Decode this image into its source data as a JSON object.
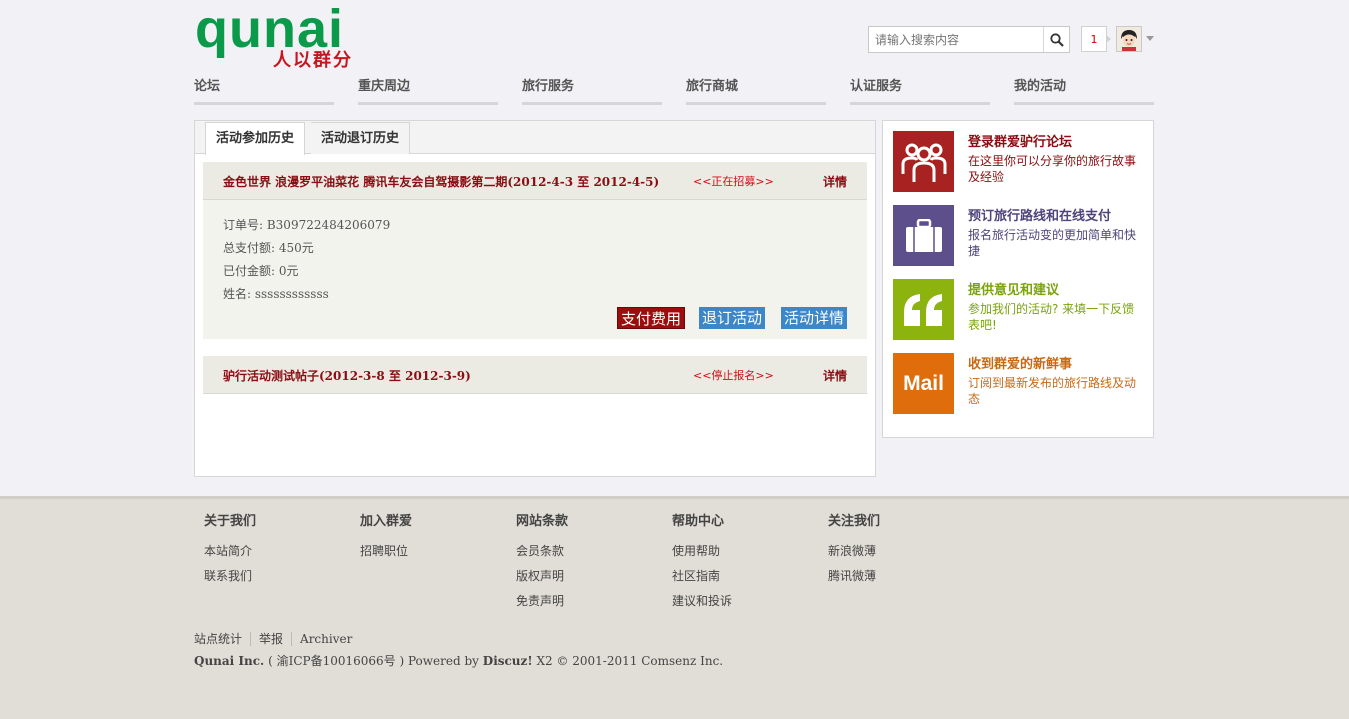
{
  "header": {
    "logo_text": "qunai",
    "logo_subtitle": "人以群分",
    "search_placeholder": "请输入搜索内容",
    "notification_count": "1"
  },
  "nav": [
    {
      "label": "论坛"
    },
    {
      "label": "重庆周边"
    },
    {
      "label": "旅行服务"
    },
    {
      "label": "旅行商城"
    },
    {
      "label": "认证服务"
    },
    {
      "label": "我的活动"
    }
  ],
  "tabs": [
    {
      "label": "活动参加历史"
    },
    {
      "label": "活动退订历史"
    }
  ],
  "activities": [
    {
      "title": "金色世界 浪漫罗平油菜花 腾讯车友会自驾摄影第二期(2012-4-3 至 2012-4-5)",
      "status": "<<正在招募>>",
      "detail_link": "详情",
      "order_no": "订单号: B309722484206079",
      "total": "总支付额: 450元",
      "paid": "已付金额: 0元",
      "name": "姓名: ssssssssssss",
      "pay_button": "支付费用",
      "cancel_button": "退订活动",
      "detail_button": "活动详情"
    },
    {
      "title": "驴行活动测试帖子(2012-3-8 至 2012-3-9)",
      "status": "<<停止报名>>",
      "detail_link": "详情"
    }
  ],
  "sidebar": [
    {
      "title": "登录群爱驴行论坛",
      "desc": "在这里你可以分享你的旅行故事及经验",
      "color": "#a82221",
      "text_color": "#8b0d13",
      "icon": "people-icon"
    },
    {
      "title": "预订旅行路线和在线支付",
      "desc": "报名旅行活动变的更加简单和快捷",
      "color": "#5c4f8c",
      "text_color": "#4f447c",
      "icon": "briefcase-icon"
    },
    {
      "title": "提供意见和建议",
      "desc": "参加我们的活动? 来填一下反馈表吧!",
      "color": "#8cb30e",
      "text_color": "#7aa30d",
      "icon": "quote-icon"
    },
    {
      "title": "收到群爱的新鲜事",
      "desc": "订阅到最新发布的旅行路线及动态",
      "color": "#e06d0b",
      "text_color": "#c86a14",
      "icon": "mail-icon",
      "icon_text": "Mail"
    }
  ],
  "footer": {
    "columns": [
      {
        "heading": "关于我们",
        "links": [
          "本站简介",
          "联系我们"
        ]
      },
      {
        "heading": "加入群爱",
        "links": [
          "招聘职位"
        ]
      },
      {
        "heading": "网站条款",
        "links": [
          "会员条款",
          "版权声明",
          "免责声明"
        ]
      },
      {
        "heading": "帮助中心",
        "links": [
          "使用帮助",
          "社区指南",
          "建议和投诉"
        ]
      },
      {
        "heading": "关注我们",
        "links": [
          "新浪微薄",
          "腾讯微薄"
        ]
      }
    ],
    "bottom_links": [
      "站点统计",
      "举报",
      "Archiver"
    ],
    "company": "Qunai Inc.",
    "icp": "( 渝ICP备10016066号 ) Powered by",
    "discuz": "Discuz!",
    "copyright_rest": "X2 © 2001-2011 Comsenz Inc."
  }
}
